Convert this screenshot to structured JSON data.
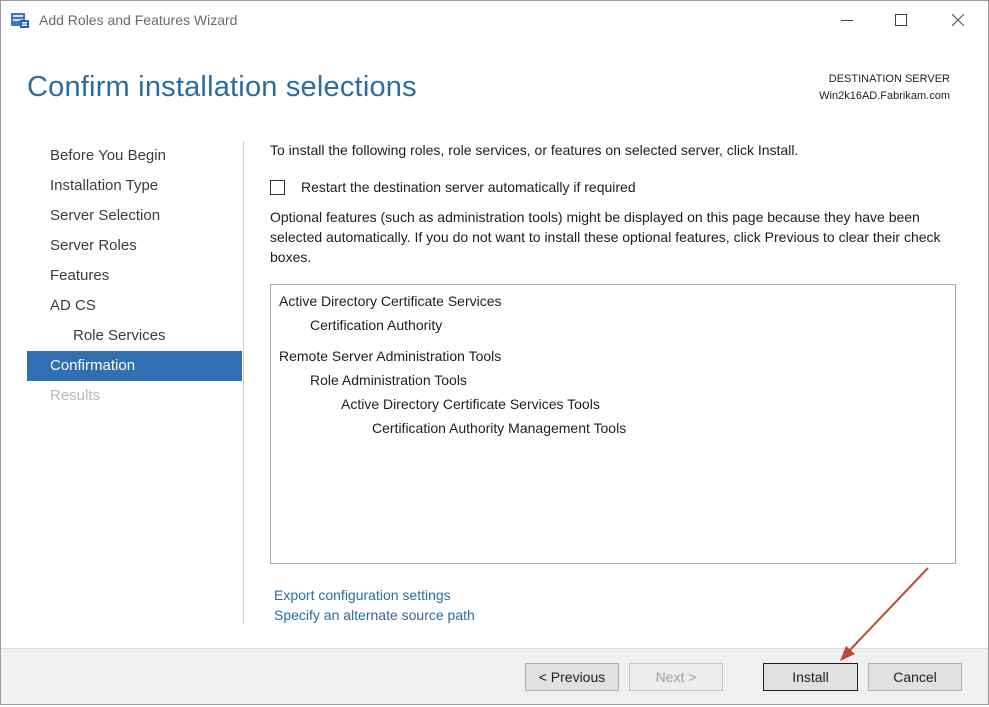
{
  "window": {
    "title": "Add Roles and Features Wizard"
  },
  "header": {
    "heading": "Confirm installation selections",
    "destination_label": "DESTINATION SERVER",
    "destination_server": "Win2k16AD.Fabrikam.com"
  },
  "nav": {
    "items": [
      {
        "label": "Before You Begin",
        "state": "normal"
      },
      {
        "label": "Installation Type",
        "state": "normal"
      },
      {
        "label": "Server Selection",
        "state": "normal"
      },
      {
        "label": "Server Roles",
        "state": "normal"
      },
      {
        "label": "Features",
        "state": "normal"
      },
      {
        "label": "AD CS",
        "state": "normal"
      },
      {
        "label": "Role Services",
        "state": "sub"
      },
      {
        "label": "Confirmation",
        "state": "active"
      },
      {
        "label": "Results",
        "state": "disabled"
      }
    ]
  },
  "main": {
    "intro": "To install the following roles, role services, or features on selected server, click Install.",
    "restart_checkbox": {
      "label": "Restart the destination server automatically if required",
      "checked": false
    },
    "optional_note": "Optional features (such as administration tools) might be displayed on this page because they have been selected automatically. If you do not want to install these optional features, click Previous to clear their check boxes.",
    "selections": [
      {
        "label": "Active Directory Certificate Services",
        "level": 0
      },
      {
        "label": "Certification Authority",
        "level": 1
      },
      {
        "label": "Remote Server Administration Tools",
        "level": 0
      },
      {
        "label": "Role Administration Tools",
        "level": 1
      },
      {
        "label": "Active Directory Certificate Services Tools",
        "level": 2
      },
      {
        "label": "Certification Authority Management Tools",
        "level": 3
      }
    ],
    "links": {
      "export": "Export configuration settings",
      "alternate_source": "Specify an alternate source path"
    }
  },
  "footer": {
    "previous": "< Previous",
    "next": "Next >",
    "install": "Install",
    "cancel": "Cancel"
  },
  "colors": {
    "heading": "#2b6ca3",
    "nav_active_bg": "#2f6fb2",
    "link": "#2b6ca3",
    "annotation_arrow": "#c0463b"
  }
}
